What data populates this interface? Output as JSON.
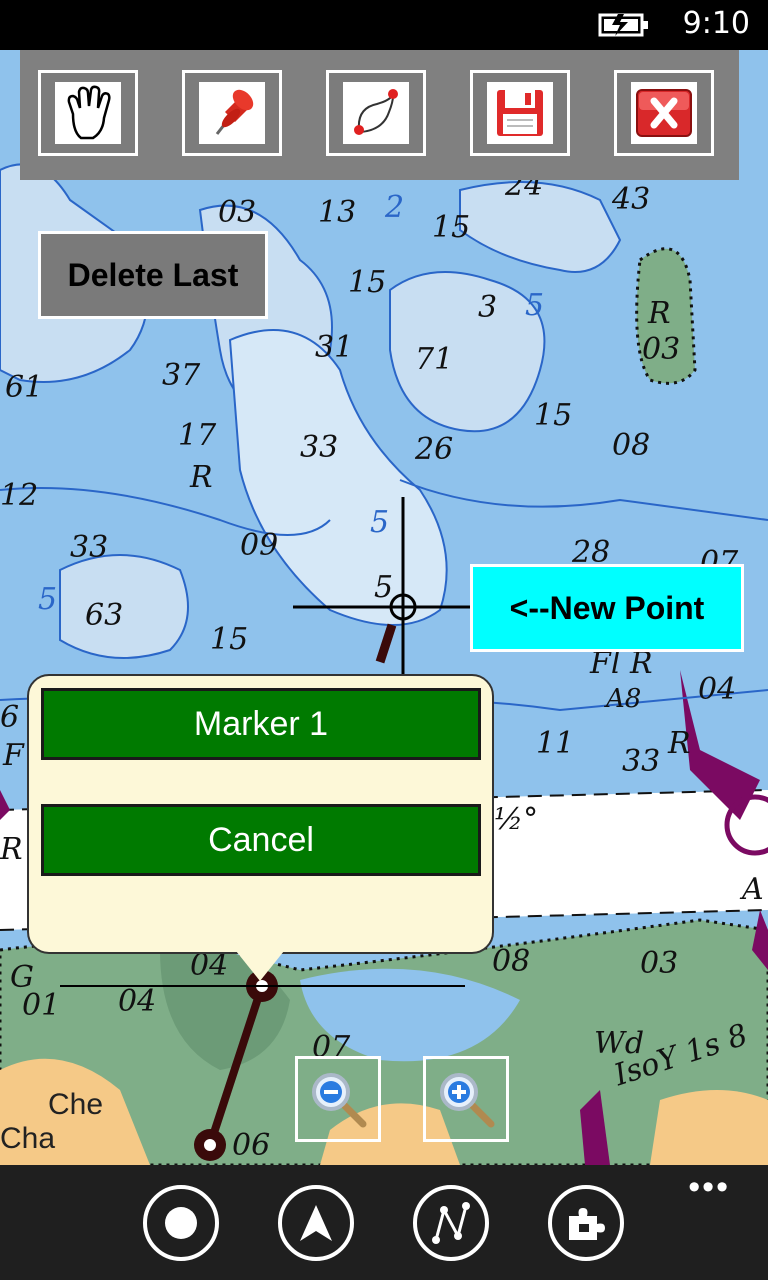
{
  "status": {
    "time": "9:10",
    "battery_icon": "battery-charging-icon"
  },
  "toolbar": {
    "items": [
      {
        "name": "pan",
        "icon": "hand-icon"
      },
      {
        "name": "place-marker",
        "icon": "pushpin-icon"
      },
      {
        "name": "route",
        "icon": "route-icon"
      },
      {
        "name": "save",
        "icon": "floppy-disk-icon"
      },
      {
        "name": "close",
        "icon": "close-icon"
      }
    ]
  },
  "actions": {
    "delete_last": "Delete Last",
    "new_point_label": "<--New Point"
  },
  "popup": {
    "marker_label": "Marker 1",
    "cancel_label": "Cancel"
  },
  "zoom": {
    "zoom_out_icon": "zoom-out-icon",
    "zoom_in_icon": "zoom-in-icon"
  },
  "appbar": {
    "buttons": [
      {
        "icon": "record-icon"
      },
      {
        "icon": "navigation-arrow-icon"
      },
      {
        "icon": "route-path-icon"
      },
      {
        "icon": "puzzle-icon"
      }
    ],
    "more_label": "•••"
  },
  "chart_labels": {
    "d03": "03",
    "d13": "13",
    "d2": "2",
    "d15a": "15",
    "d24": "24",
    "d43": "43",
    "d3": "3",
    "d5a": "5",
    "dR1": "R",
    "d03b": "03",
    "d15b": "15",
    "d31": "31",
    "d71": "71",
    "d37": "37",
    "d61": "61",
    "d17": "17",
    "dR2": "R",
    "d33a": "33",
    "d26": "26",
    "d15c": "15",
    "d08": "08",
    "d12": "12",
    "d33b": "33",
    "d09": "09",
    "d5b": "5",
    "d28": "28",
    "d07": "07",
    "d5c": "5",
    "d63": "63",
    "d15d": "15",
    "d5d": "5",
    "dFlR": "Fl R",
    "dA8": "A8",
    "d04": "04",
    "dR3": "R",
    "d33c": "33",
    "d11": "11",
    "d6": "6",
    "dF": "F",
    "dRleft": "R",
    "dhalf": "½°",
    "dA": "A",
    "d04b": "04",
    "dG": "G",
    "d01": "01",
    "d04c": "04",
    "d08b": "08",
    "d03c": "03",
    "d07b": "07",
    "dWd": "Wd",
    "dIso": "IsoY 1s 8",
    "d06": "06",
    "dChe": "Che",
    "dCha": "Cha"
  }
}
